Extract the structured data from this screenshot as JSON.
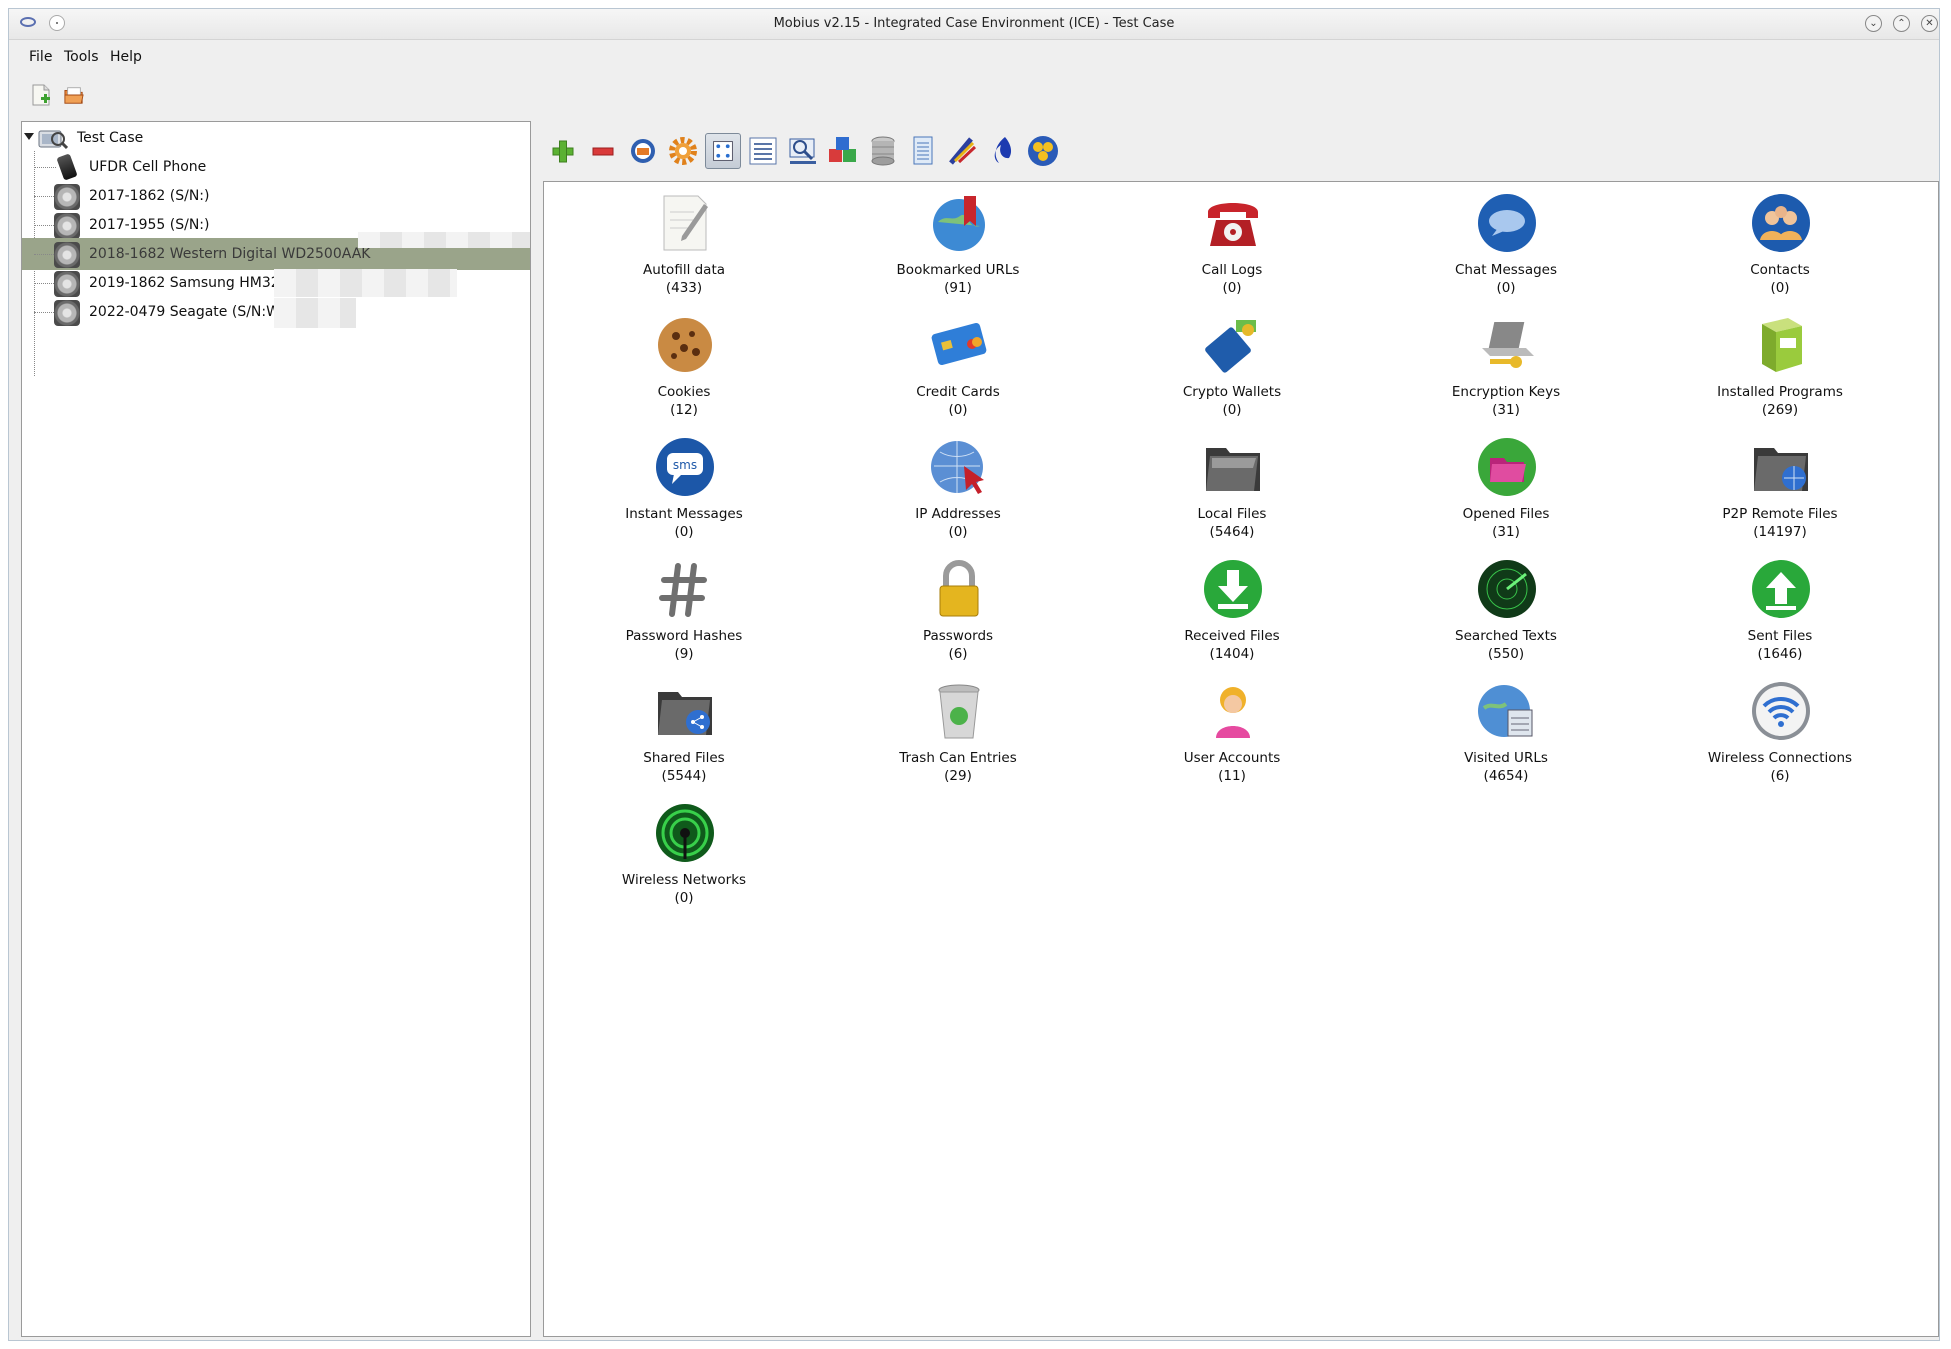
{
  "window": {
    "title": "Mobius v2.15 - Integrated Case Environment (ICE) - Test Case",
    "controls": [
      "minimize",
      "maximize",
      "close"
    ]
  },
  "menu": [
    "File",
    "Tools",
    "Help"
  ],
  "tree": {
    "root": "Test Case",
    "items": [
      {
        "label": "UFDR Cell Phone",
        "icon": "phone-icon"
      },
      {
        "label": "2017-1862   (S/N:)",
        "icon": "disk-icon"
      },
      {
        "label": "2017-1955   (S/N:)",
        "icon": "disk-icon"
      },
      {
        "label": "2018-1682 Western Digital WD2500AAK",
        "icon": "disk-icon",
        "selected": true
      },
      {
        "label": "2019-1862 Samsung HM32",
        "icon": "disk-icon"
      },
      {
        "label": "2022-0479 Seagate  (S/N:W",
        "icon": "disk-icon"
      }
    ]
  },
  "toolbar": [
    "add-icon",
    "remove-icon",
    "database-icon",
    "settings-icon",
    "icon-view-icon",
    "list-view-icon",
    "search-icon",
    "blocks-icon",
    "storage-icon",
    "report-icon",
    "wand-icon",
    "flame-icon",
    "hub-icon"
  ],
  "artifacts": [
    {
      "name": "Autofill data",
      "count": "(433)"
    },
    {
      "name": "Bookmarked URLs",
      "count": "(91)"
    },
    {
      "name": "Call Logs",
      "count": "(0)"
    },
    {
      "name": "Chat Messages",
      "count": "(0)"
    },
    {
      "name": "Contacts",
      "count": "(0)"
    },
    {
      "name": "Cookies",
      "count": "(12)"
    },
    {
      "name": "Credit Cards",
      "count": "(0)"
    },
    {
      "name": "Crypto Wallets",
      "count": "(0)"
    },
    {
      "name": "Encryption Keys",
      "count": "(31)"
    },
    {
      "name": "Installed Programs",
      "count": "(269)"
    },
    {
      "name": "Instant Messages",
      "count": "(0)"
    },
    {
      "name": "IP Addresses",
      "count": "(0)"
    },
    {
      "name": "Local Files",
      "count": "(5464)"
    },
    {
      "name": "Opened Files",
      "count": "(31)"
    },
    {
      "name": "P2P Remote Files",
      "count": "(14197)"
    },
    {
      "name": "Password Hashes",
      "count": "(9)"
    },
    {
      "name": "Passwords",
      "count": "(6)"
    },
    {
      "name": "Received Files",
      "count": "(1404)"
    },
    {
      "name": "Searched Texts",
      "count": "(550)"
    },
    {
      "name": "Sent Files",
      "count": "(1646)"
    },
    {
      "name": "Shared Files",
      "count": "(5544)"
    },
    {
      "name": "Trash Can Entries",
      "count": "(29)"
    },
    {
      "name": "User Accounts",
      "count": "(11)"
    },
    {
      "name": "Visited URLs",
      "count": "(4654)"
    },
    {
      "name": "Wireless Connections",
      "count": "(6)"
    },
    {
      "name": "Wireless Networks",
      "count": "(0)"
    }
  ],
  "icon_sms_text": "sms"
}
